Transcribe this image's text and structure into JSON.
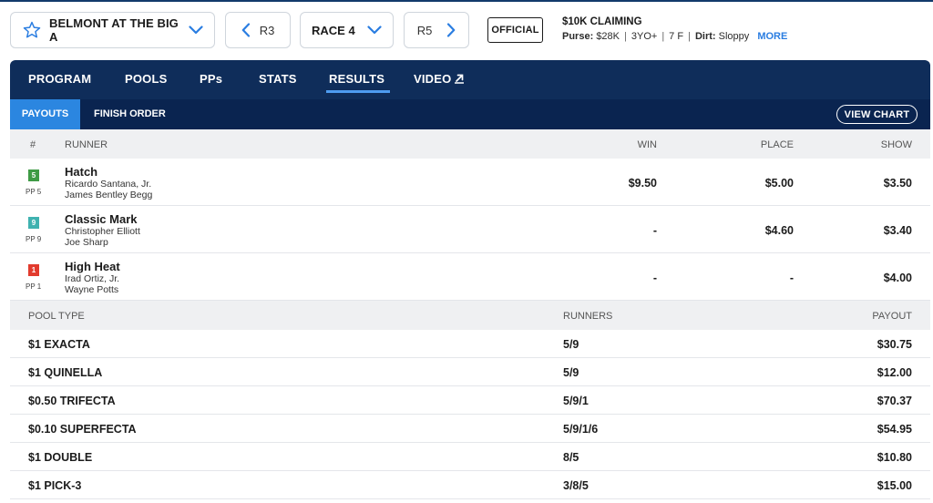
{
  "header": {
    "track": "BELMONT AT THE BIG A",
    "prev_race": "R3",
    "race": "RACE 4",
    "next_race": "R5",
    "status": "OFFICIAL",
    "race_title": "$10K CLAIMING",
    "purse_label": "Purse:",
    "purse": "$28K",
    "age": "3YO+",
    "distance": "7 F",
    "surface_label": "Dirt:",
    "surface": "Sloppy",
    "more": "MORE"
  },
  "tabs": [
    "PROGRAM",
    "POOLS",
    "PPs",
    "STATS",
    "RESULTS",
    "VIDEO"
  ],
  "active_tab": "RESULTS",
  "subtabs": [
    "PAYOUTS",
    "FINISH ORDER"
  ],
  "view_chart": "VIEW CHART",
  "runner_table": {
    "headers": {
      "num": "#",
      "runner": "RUNNER",
      "win": "WIN",
      "place": "PLACE",
      "show": "SHOW"
    },
    "rows": [
      {
        "pp": "5",
        "pp_label": "PP 5",
        "pp_color": "#3f9b45",
        "name": "Hatch",
        "jockey": "Ricardo Santana, Jr.",
        "trainer": "James Bentley Begg",
        "win": "$9.50",
        "place": "$5.00",
        "show": "$3.50"
      },
      {
        "pp": "9",
        "pp_color": "#3fb2b0",
        "pp_label": "PP 9",
        "name": "Classic Mark",
        "jockey": "Christopher Elliott",
        "trainer": "Joe Sharp",
        "win": "-",
        "place": "$4.60",
        "show": "$3.40"
      },
      {
        "pp": "1",
        "pp_color": "#e23b2e",
        "pp_label": "PP 1",
        "name": "High Heat",
        "jockey": "Irad Ortiz, Jr.",
        "trainer": "Wayne Potts",
        "win": "-",
        "place": "-",
        "show": "$4.00"
      }
    ]
  },
  "pool_table": {
    "headers": {
      "type": "POOL TYPE",
      "runners": "RUNNERS",
      "payout": "PAYOUT"
    },
    "rows": [
      {
        "type": "$1 EXACTA",
        "runners": "5/9",
        "payout": "$30.75"
      },
      {
        "type": "$1 QUINELLA",
        "runners": "5/9",
        "payout": "$12.00"
      },
      {
        "type": "$0.50 TRIFECTA",
        "runners": "5/9/1",
        "payout": "$70.37"
      },
      {
        "type": "$0.10 SUPERFECTA",
        "runners": "5/9/1/6",
        "payout": "$54.95"
      },
      {
        "type": "$1 DOUBLE",
        "runners": "8/5",
        "payout": "$10.80"
      },
      {
        "type": "$1 PICK-3",
        "runners": "3/8/5",
        "payout": "$15.00"
      }
    ]
  },
  "colors": {
    "navy": "#0f2d5a",
    "accent": "#2b86e0",
    "link": "#2a7de1"
  }
}
